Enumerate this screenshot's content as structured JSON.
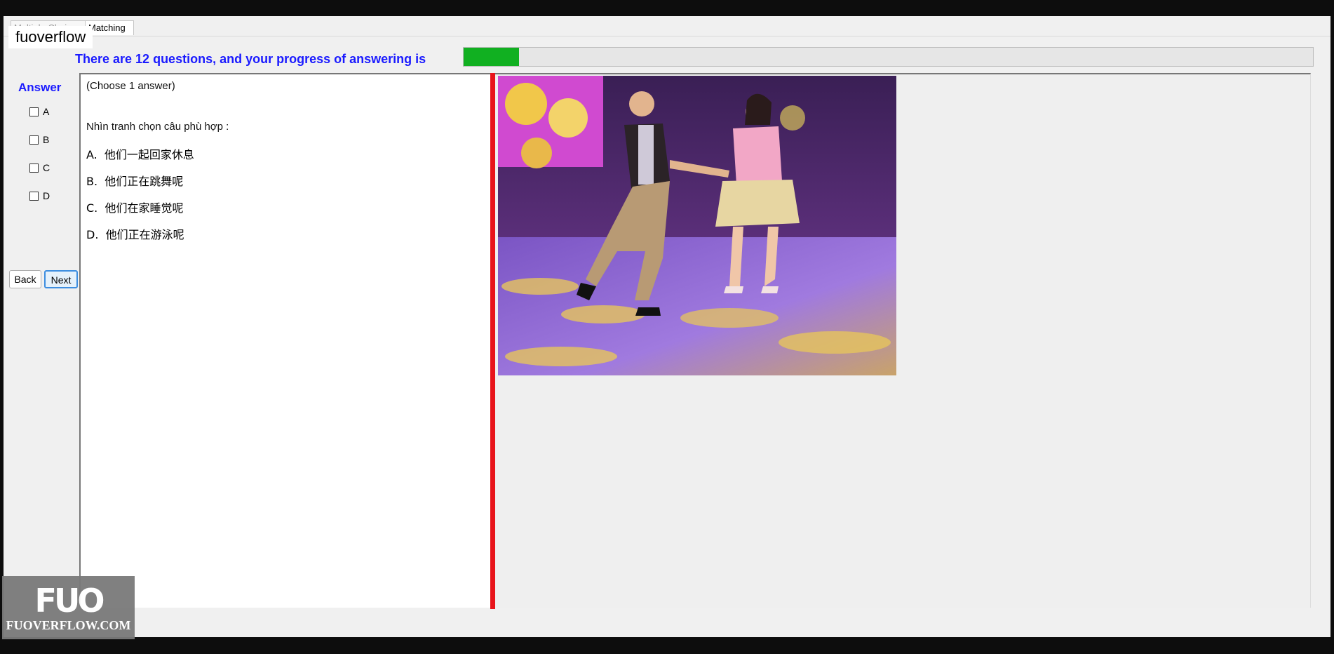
{
  "tabs": [
    {
      "label": "Multiple Choice",
      "active": false
    },
    {
      "label": "Matching",
      "active": true
    }
  ],
  "watermark_top": "fuoverflow",
  "progress": {
    "label": "There are 12 questions, and your progress of answering is",
    "fraction": 0.065,
    "fill_color": "#11b021"
  },
  "answer": {
    "title": "Answer",
    "options": [
      "A",
      "B",
      "C",
      "D"
    ]
  },
  "buttons": {
    "back": "Back",
    "next": "Next"
  },
  "question": {
    "instruction": "(Choose 1 answer)",
    "prompt": "Nhìn tranh chọn câu phù hợp :",
    "choices": [
      {
        "letter": "A.",
        "text": "他们一起回家休息"
      },
      {
        "letter": "B.",
        "text": "他们正在跳舞呢"
      },
      {
        "letter": "C.",
        "text": "他们在家睡觉呢"
      },
      {
        "letter": "D.",
        "text": "他们正在游泳呢"
      }
    ]
  },
  "image": {
    "subject": "couple-dancing-photo"
  },
  "logo": {
    "mark": "FUO",
    "text": "FUOVERFLOW.COM"
  }
}
